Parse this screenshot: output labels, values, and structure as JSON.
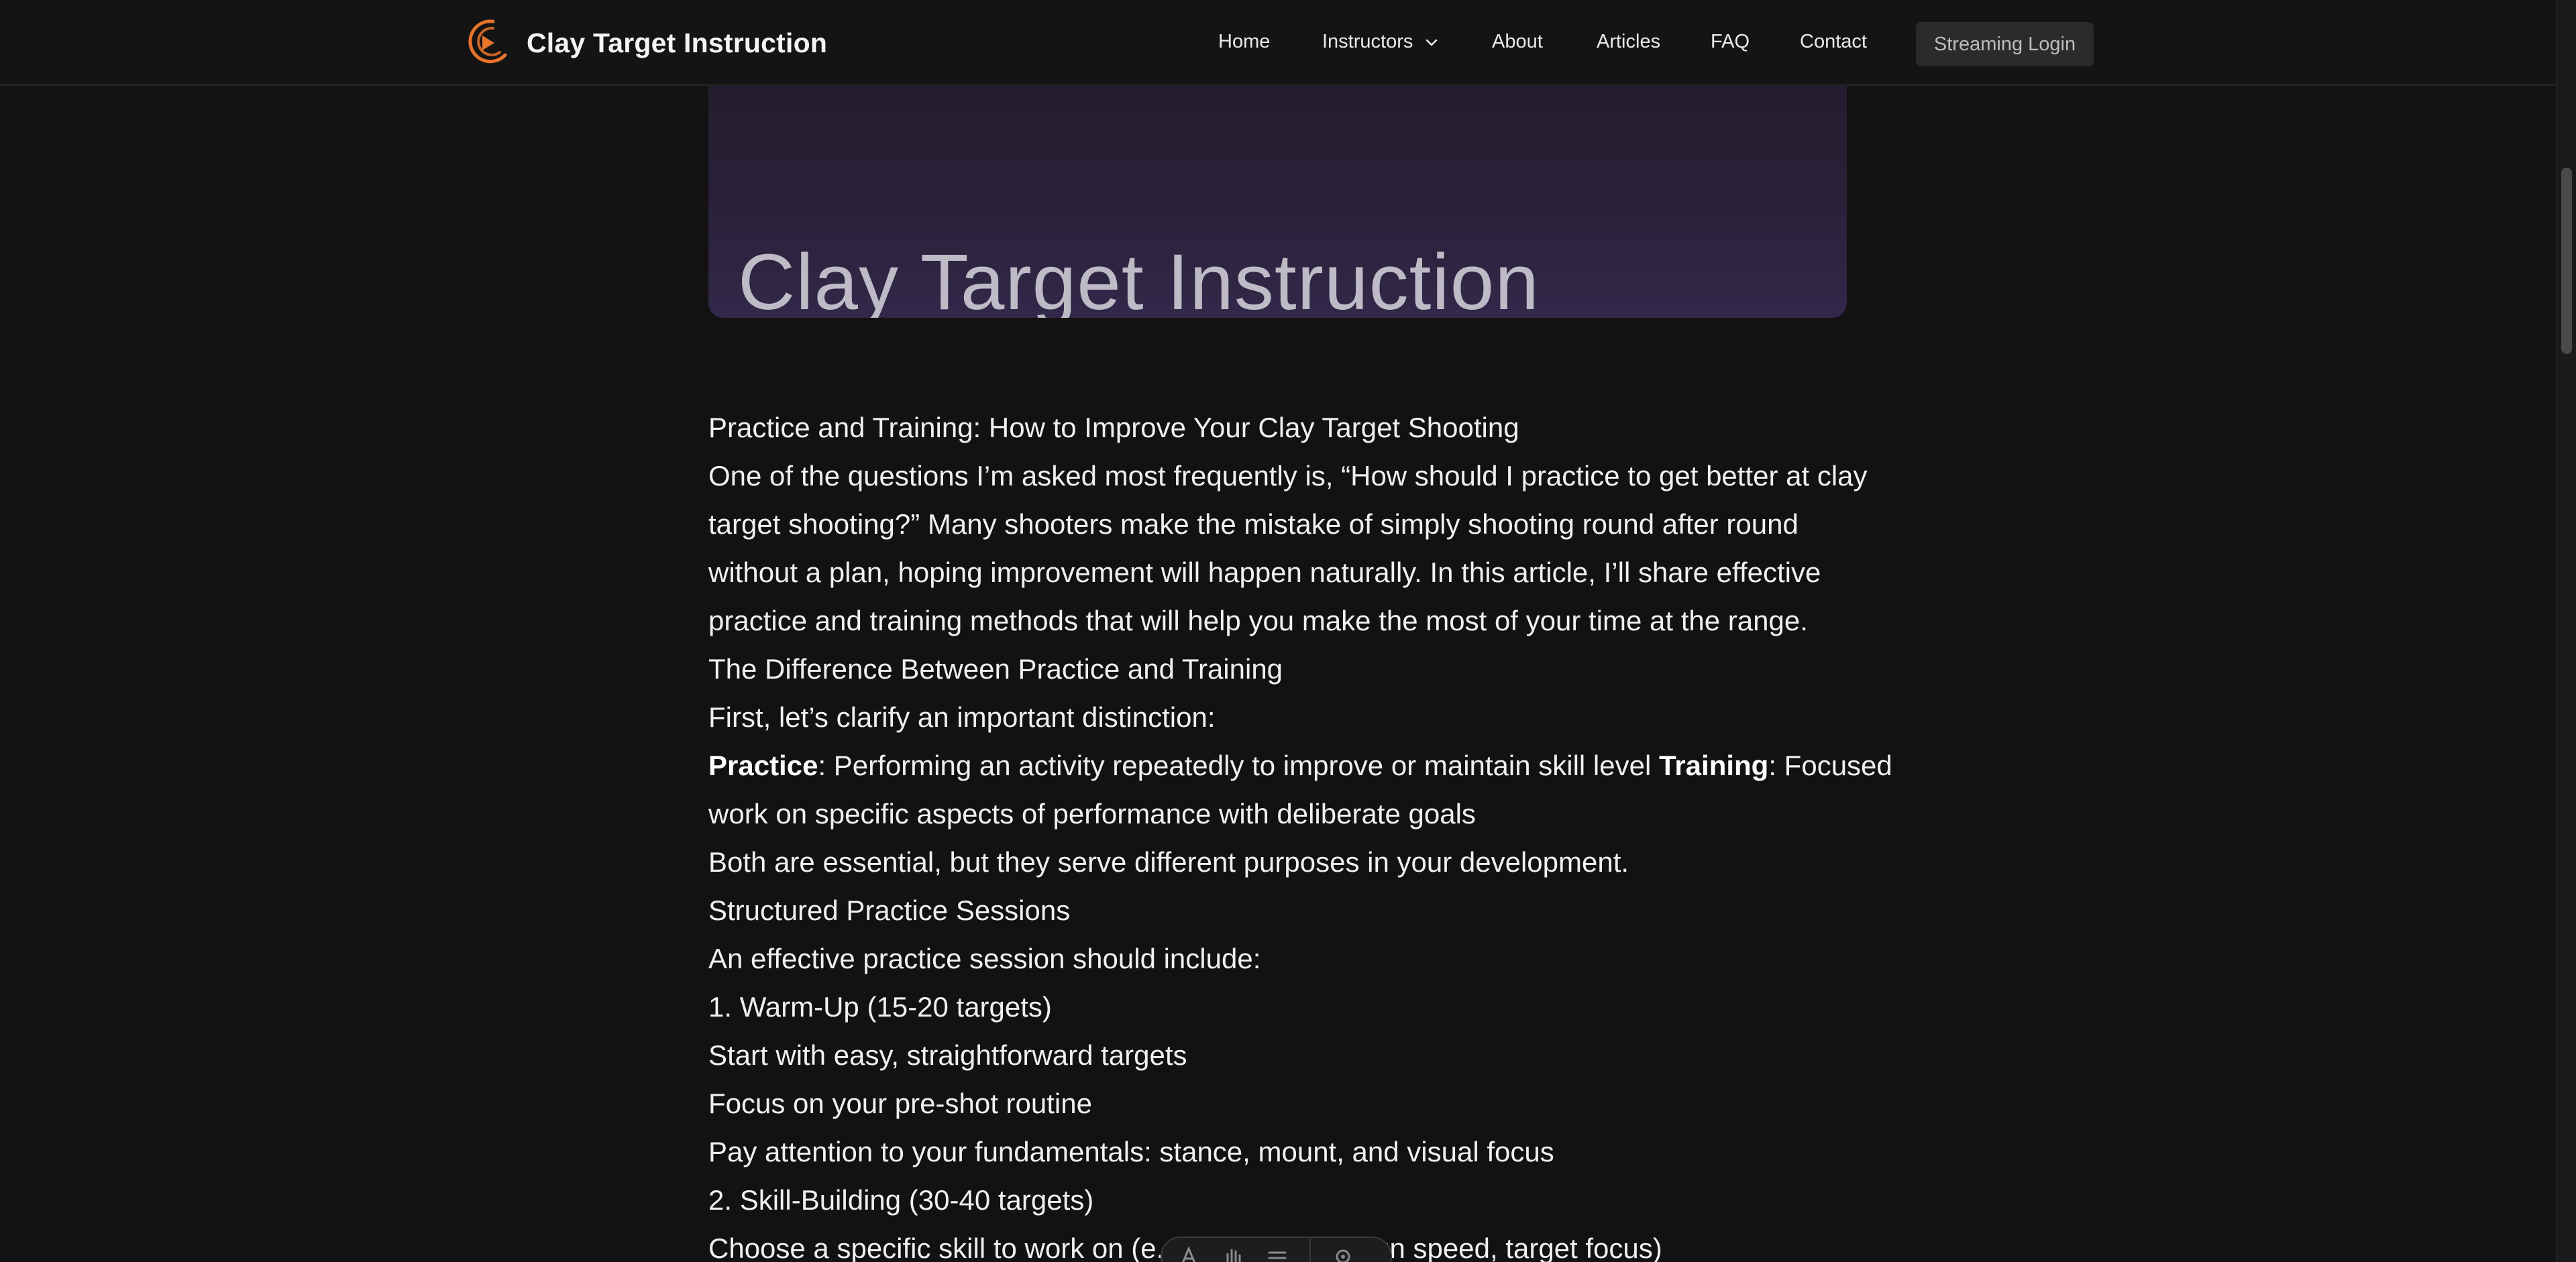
{
  "header": {
    "brand_name": "Clay Target Instruction",
    "nav": {
      "home": "Home",
      "instructors": "Instructors",
      "about": "About",
      "articles": "Articles",
      "faq": "FAQ",
      "contact": "Contact"
    },
    "login_label": "Streaming Login"
  },
  "hero": {
    "title": "Clay Target Instruction"
  },
  "article": {
    "title": "Practice and Training: How to Improve Your Clay Target Shooting",
    "intro": [
      "One of the questions I’m asked most frequently is, “How should I practice to get better at clay",
      "target shooting?” Many shooters make the mistake of simply shooting round after round",
      "without a plan, hoping improvement will happen naturally. In this article, I’ll share effective",
      "practice and training methods that will help you make the most of your time at the range."
    ],
    "section1_heading": "The Difference Between Practice and Training",
    "distinction_intro": "First, let’s clarify an important distinction:",
    "practice_term": "Practice",
    "practice_def": ": Performing an activity repeatedly to improve or maintain skill level ",
    "training_term": "Training",
    "training_def": ": Focused",
    "training_def_cont": "work on specific aspects of performance with deliberate goals",
    "both_essential": "Both are essential, but they serve different purposes in your development.",
    "section2_heading": "Structured Practice Sessions",
    "session_intro": "An effective practice session should include:",
    "step1_heading": "1. Warm-Up (15-20 targets)",
    "step1_items": [
      "Start with easy, straightforward targets",
      "Focus on your pre-shot routine",
      "Pay attention to your fundamentals: stance, mount, and visual focus"
    ],
    "step2_heading": "2. Skill-Building (30-40 targets)",
    "step2_first_item": "Choose a specific skill to work on (e.g., break point, gun speed, target focus)"
  },
  "colors": {
    "background": "#121212",
    "header_bg": "#141414",
    "brand_accent": "#e8732a",
    "hero_gradient_end": "#33284a"
  },
  "icons": {
    "logo": "play-ring-logo",
    "instructors_dropdown": "chevron-down-icon"
  }
}
